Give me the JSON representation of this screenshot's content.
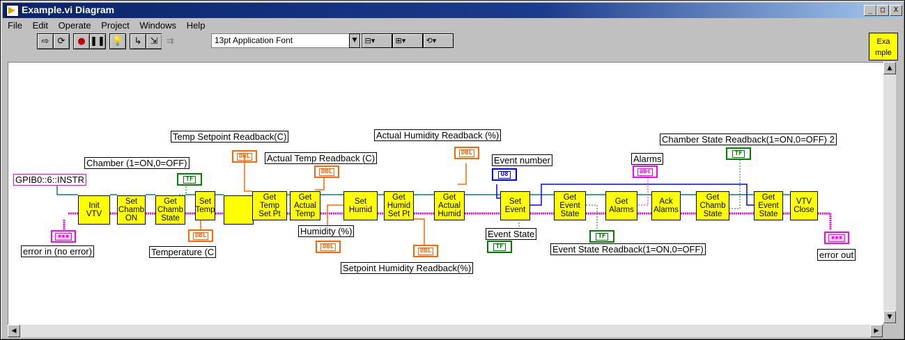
{
  "window": {
    "title": "Example.vi Diagram"
  },
  "title_buttons": {
    "minimize": "_",
    "maximize": "□",
    "close": "X"
  },
  "menu": [
    "File",
    "Edit",
    "Operate",
    "Project",
    "Windows",
    "Help"
  ],
  "toolbar": {
    "run_icon": "run-arrow-icon",
    "font": "13pt Application Font"
  },
  "vi_icon": {
    "line1": "Exa",
    "line2": "mple"
  },
  "nodes": {
    "init": "Init\nVTV",
    "set_chamb_on": "Set\nChamb\nON",
    "get_chamb_state": "Get\nChamb\nState",
    "set_temp": "Set\nTemp",
    "get_temp_set_pt": "Get\nTemp\nSet Pt",
    "get_actual_temp": "Get\nActual\nTemp",
    "set_humid": "Set\nHumid",
    "get_humid_set_pt": "Get\nHumid\nSet Pt",
    "get_actual_humid": "Get\nActual\nHumid",
    "set_event": "Set\nEvent",
    "get_event_state": "Get\nEvent\nState",
    "get_alarms": "Get\nAlarms",
    "ack_alarms": "Ack\nAlarms",
    "get_chamb_state_2": "Get\nChamb\nState",
    "get_event_state_2": "Get\nEvent\nState",
    "vtv_close": "VTV\nClose"
  },
  "labels": {
    "gpib": "GPIB0::6::INSTR",
    "error_in": "error in (no error)",
    "chamber": "Chamber (1=ON,0=OFF)",
    "temperature": "Temperature (C",
    "temp_setpoint": "Temp Setpoint Readback(C)",
    "actual_temp": "Actual Temp Readback (C)",
    "humidity": "Humidity (%)",
    "actual_humidity": "Actual Humidity Readback (%)",
    "setpoint_humidity": "Setpoint Humidity Readback(%)",
    "event_number": "Event number",
    "event_state": "Event State",
    "event_state_readback": "Event State Readback(1=ON,0=OFF)",
    "alarms": "Alarms",
    "chamber_state_readback": "Chamber State Readback(1=ON,0=OFF) 2",
    "error_out": "error out"
  },
  "terminal_types": {
    "dbl": "DBL",
    "tf": "TF",
    "u8": "U8",
    "abc": "abc",
    "cluster": "▪▪▪"
  },
  "colors": {
    "dbl": "#ff6600",
    "bool": "#008000",
    "u8": "#0000ff",
    "string": "#ff00ff",
    "node": "#ffff00"
  }
}
